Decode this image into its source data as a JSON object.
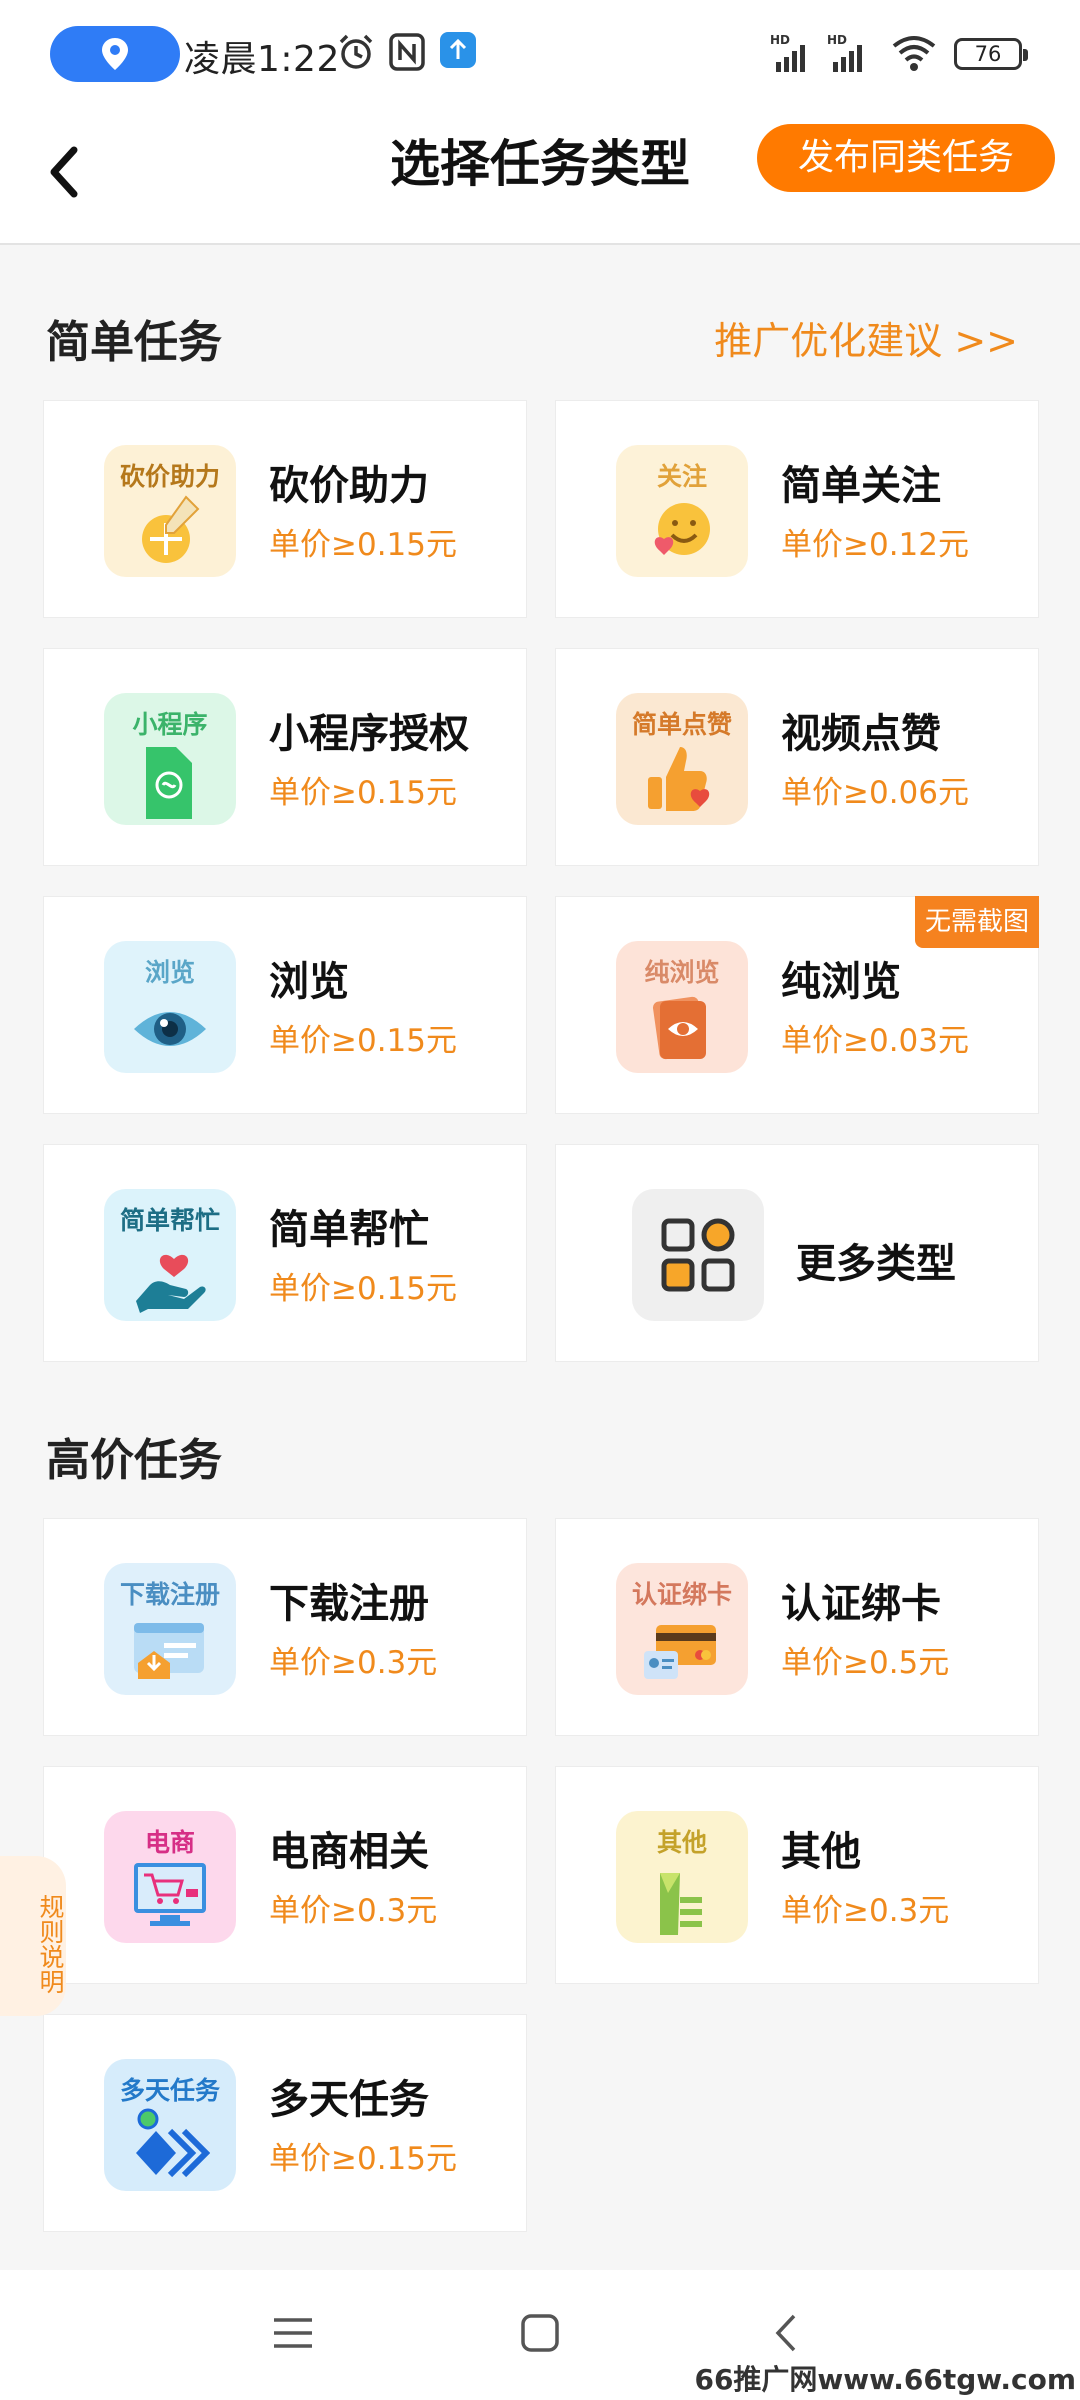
{
  "status_bar": {
    "time": "凌晨1:22",
    "battery": "76",
    "icons": [
      "location-icon",
      "alarm-icon",
      "nfc-icon",
      "upload-icon",
      "hd-signal-icon",
      "wifi-icon",
      "battery-icon"
    ]
  },
  "header": {
    "title": "选择任务类型",
    "publish_label": "发布同类任务"
  },
  "simple_section": {
    "title": "简单任务",
    "link": "推广优化建议 >>",
    "cards": [
      {
        "name": "砍价助力",
        "price": "单价≥0.15元",
        "icon_label": "砍价助力",
        "icon": "bargain-icon",
        "tile_color": "#fdf1d6",
        "label_color": "#b5781b"
      },
      {
        "name": "简单关注",
        "price": "单价≥0.12元",
        "icon_label": "关注",
        "icon": "follow-smile-icon",
        "tile_color": "#fdf2d8",
        "label_color": "#e1a23a"
      },
      {
        "name": "小程序授权",
        "price": "单价≥0.15元",
        "icon_label": "小程序",
        "icon": "mini-program-icon",
        "tile_color": "#dcf7e7",
        "label_color": "#3bb36a"
      },
      {
        "name": "视频点赞",
        "price": "单价≥0.06元",
        "icon_label": "简单点赞",
        "icon": "thumbs-up-icon",
        "tile_color": "#fbe8d2",
        "label_color": "#d57a2a"
      },
      {
        "name": "浏览",
        "price": "单价≥0.15元",
        "icon_label": "浏览",
        "icon": "eye-icon",
        "tile_color": "#dff3fb",
        "label_color": "#5aa6c8"
      },
      {
        "name": "纯浏览",
        "price": "单价≥0.03元",
        "icon_label": "纯浏览",
        "icon": "pure-browse-icon",
        "tile_color": "#fde3d8",
        "label_color": "#d98a68",
        "badge": "无需截图"
      },
      {
        "name": "简单帮忙",
        "price": "单价≥0.15元",
        "icon_label": "简单帮忙",
        "icon": "helping-hand-icon",
        "tile_color": "#dcf3fb",
        "label_color": "#1d6e85"
      }
    ],
    "more_label": "更多类型"
  },
  "premium_section": {
    "title": "高价任务",
    "cards": [
      {
        "name": "下载注册",
        "price": "单价≥0.3元",
        "icon_label": "下载注册",
        "icon": "download-register-icon",
        "tile_color": "#dff0fb",
        "label_color": "#4a8ec2"
      },
      {
        "name": "认证绑卡",
        "price": "单价≥0.5元",
        "icon_label": "认证绑卡",
        "icon": "bind-card-icon",
        "tile_color": "#fde5dc",
        "label_color": "#d4785d"
      },
      {
        "name": "电商相关",
        "price": "单价≥0.3元",
        "icon_label": "电商",
        "icon": "ecommerce-icon",
        "tile_color": "#fdd8ec",
        "label_color": "#d62f86"
      },
      {
        "name": "其他",
        "price": "单价≥0.3元",
        "icon_label": "其他",
        "icon": "other-icon",
        "tile_color": "#fcf3cf",
        "label_color": "#c4a22a"
      },
      {
        "name": "多天任务",
        "price": "单价≥0.15元",
        "icon_label": "多天任务",
        "icon": "multi-day-icon",
        "tile_color": "#d6ecfb",
        "label_color": "#2379c9"
      }
    ]
  },
  "rules_tab": "规则说明",
  "watermark": "66推广网www.66tgw.com",
  "colors": {
    "accent": "#ff7a00",
    "price": "#f08a1c",
    "background": "#f6f6f6"
  }
}
